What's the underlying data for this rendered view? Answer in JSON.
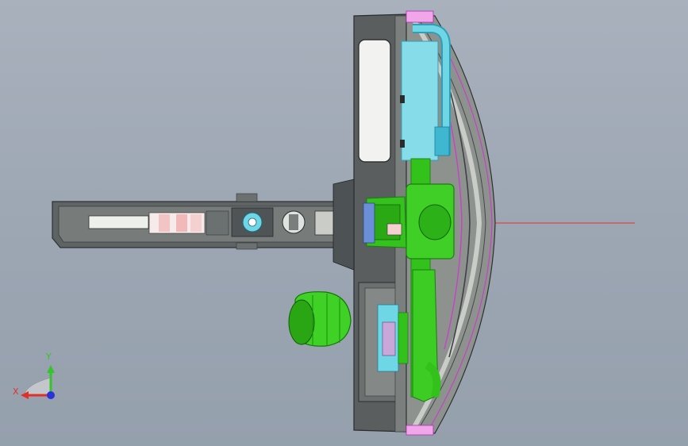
{
  "viewport": {
    "background": "#a2abb8"
  },
  "colors": {
    "housing_dark": "#5a5e5f",
    "housing_mid": "#7b807e",
    "housing_light": "#c9ccc7",
    "green_part": "#33c21c",
    "green_dark": "#1f8a12",
    "cyan_part": "#6fd6e6",
    "cyan_dark": "#2f9fb8",
    "magenta_edge": "#c642c8",
    "pink_part": "#f3c4c4",
    "reference_line": "#e0352d",
    "axis_x": "#e0302a",
    "axis_y": "#35c42c",
    "axis_z": "#2a33d8"
  },
  "triad": {
    "x_label": "X",
    "y_label": "Y"
  }
}
